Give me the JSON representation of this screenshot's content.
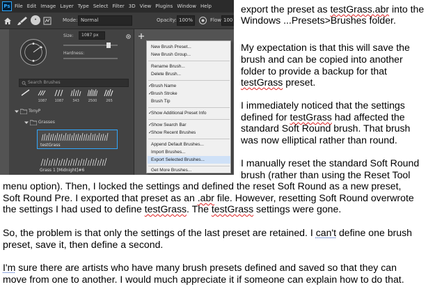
{
  "photoshop": {
    "logo": "Ps",
    "menu_items": [
      "File",
      "Edit",
      "Image",
      "Layer",
      "Type",
      "Select",
      "Filter",
      "3D",
      "View",
      "Plugins",
      "Window",
      "Help"
    ],
    "options_bar": {
      "brush_size_badge": "•",
      "mode_label": "Mode:",
      "mode_value": "Normal",
      "opacity_label": "Opacity:",
      "opacity_value": "100%",
      "flow_label": "Flow:",
      "flow_value": "100"
    },
    "brush_panel": {
      "size_label": "Size:",
      "size_value": "1087 px",
      "hardness_label": "Hardness:",
      "search_placeholder": "Search Brushes",
      "recent_brushes": [
        "",
        "1087",
        "1087",
        "343",
        "2500",
        "265"
      ],
      "folder_tonyp": "TonyP",
      "folder_grasses": "Grasses",
      "preset_testgrass": "testGrass",
      "preset_grass1": "Grass 1 [Midnight]#6"
    },
    "flyout_menu": {
      "new_brush_preset": "New Brush Preset...",
      "new_brush_group": "New Brush Group...",
      "rename_brush": "Rename Brush...",
      "delete_brush": "Delete Brush...",
      "brush_name": "Brush Name",
      "brush_stroke": "Brush Stroke",
      "brush_tip": "Brush Tip",
      "show_additional_preset_info": "Show Additional Preset Info",
      "show_search_bar": "Show Search Bar",
      "show_recent_brushes": "Show Recent Brushes",
      "append_default_brushes": "Append Default Brushes...",
      "import_brushes": "Import Brushes...",
      "export_selected_brushes": "Export Selected Brushes...",
      "get_more_brushes": "Get More Brushes...",
      "check": "✓"
    },
    "colors": {
      "accent": "#31a8ff",
      "menu_highlight": "#cfe1f7",
      "panel": "#424242",
      "menubar": "#2b2b2b"
    }
  },
  "document": {
    "right_col": {
      "l1": {
        "a": "export the preset as ",
        "b": "testGrass.abr",
        "c": " into the"
      },
      "l2": "Windows ...Presets>Brushes folder.",
      "l3": "My expectation is that this will save the",
      "l4": "brush and can be copied into another",
      "l5": "folder to provide a backup for that",
      "l6": {
        "a": "testGrass",
        "b": " preset."
      },
      "l7": "I immediately noticed that the settings",
      "l8": {
        "a": "defined for ",
        "b": "testGrass",
        "c": " had affected the"
      },
      "l9": "standard Soft Round brush.  That brush",
      "l10": "was now elliptical rather than round.",
      "l11": "I manually reset the standard Soft Round"
    },
    "full": {
      "l12": "brush (rather than using the Reset Tool",
      "l13": "menu option).  Then, I locked the settings and defined the reset Soft Round as a new preset,",
      "l14": {
        "a": "Soft Round Pre.  I exported that preset as an ",
        "b": ".abr",
        "c": " file.  However, resetting Soft Round overwrote"
      },
      "l15": {
        "a": "the settings I had used to define ",
        "b": "testGrass",
        "c": ".  The ",
        "d": "testGrass",
        "e": " settings were gone."
      },
      "l16": {
        "a": "So, the problem is that only the settings of the last preset are retained.  I ",
        "b": "can't",
        "c": " define one brush"
      },
      "l17": "preset, save it, then define a second.",
      "l18": {
        "a": "I'm",
        "b": " sure there are artists who have many brush presets defined and saved so that they can"
      },
      "l19": "move from one to another.  I would much appreciate it if someone can explain how to do that."
    }
  }
}
